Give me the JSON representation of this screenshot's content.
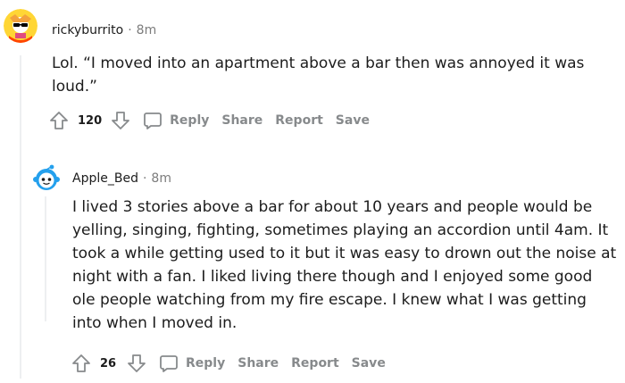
{
  "comments": [
    {
      "username": "rickyburrito",
      "separator": "·",
      "time": "8m",
      "body_lines": [
        "Lol. “I moved into an apartment above a bar then was annoyed it was",
        "loud.”"
      ],
      "votes": "120",
      "actions": {
        "reply": "Reply",
        "share": "Share",
        "report": "Report",
        "save": "Save"
      }
    },
    {
      "username": "Apple_Bed",
      "separator": "·",
      "time": "8m",
      "body_lines": [
        "I lived 3 stories above a bar for about 10 years and people would be",
        "yelling, singing, fighting, sometimes playing an accordion until 4am. It",
        "took a while getting used to it but it was easy to drown out the noise at",
        "night with a fan. I liked living there though and I enjoyed some good",
        "ole people watching from my fire escape. I knew what I was getting",
        "into when I moved in."
      ],
      "votes": "26",
      "actions": {
        "reply": "Reply",
        "share": "Share",
        "report": "Report",
        "save": "Save"
      }
    }
  ],
  "icons": {
    "upvote": "upvote-arrow-icon",
    "downvote": "downvote-arrow-icon",
    "reply": "speech-bubble-icon"
  },
  "colors": {
    "text": "#1c1c1c",
    "meta": "#7c7c7c",
    "action": "#878a8c",
    "avatar_blue": "#0dd3bb",
    "avatar_orange": "#ff8717"
  }
}
